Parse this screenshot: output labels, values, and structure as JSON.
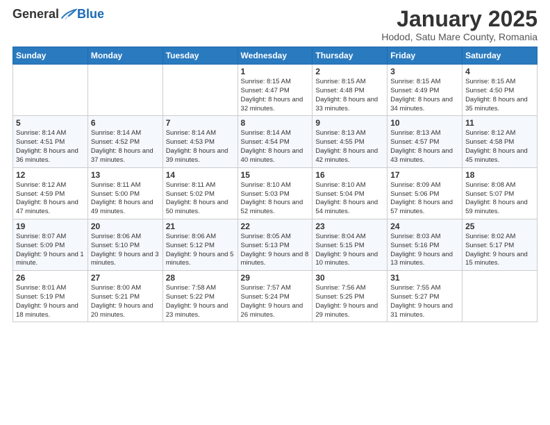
{
  "header": {
    "logo_general": "General",
    "logo_blue": "Blue",
    "cal_title": "January 2025",
    "cal_subtitle": "Hodod, Satu Mare County, Romania"
  },
  "weekdays": [
    "Sunday",
    "Monday",
    "Tuesday",
    "Wednesday",
    "Thursday",
    "Friday",
    "Saturday"
  ],
  "weeks": [
    [
      {
        "day": "",
        "info": ""
      },
      {
        "day": "",
        "info": ""
      },
      {
        "day": "",
        "info": ""
      },
      {
        "day": "1",
        "info": "Sunrise: 8:15 AM\nSunset: 4:47 PM\nDaylight: 8 hours\nand 32 minutes."
      },
      {
        "day": "2",
        "info": "Sunrise: 8:15 AM\nSunset: 4:48 PM\nDaylight: 8 hours\nand 33 minutes."
      },
      {
        "day": "3",
        "info": "Sunrise: 8:15 AM\nSunset: 4:49 PM\nDaylight: 8 hours\nand 34 minutes."
      },
      {
        "day": "4",
        "info": "Sunrise: 8:15 AM\nSunset: 4:50 PM\nDaylight: 8 hours\nand 35 minutes."
      }
    ],
    [
      {
        "day": "5",
        "info": "Sunrise: 8:14 AM\nSunset: 4:51 PM\nDaylight: 8 hours\nand 36 minutes."
      },
      {
        "day": "6",
        "info": "Sunrise: 8:14 AM\nSunset: 4:52 PM\nDaylight: 8 hours\nand 37 minutes."
      },
      {
        "day": "7",
        "info": "Sunrise: 8:14 AM\nSunset: 4:53 PM\nDaylight: 8 hours\nand 39 minutes."
      },
      {
        "day": "8",
        "info": "Sunrise: 8:14 AM\nSunset: 4:54 PM\nDaylight: 8 hours\nand 40 minutes."
      },
      {
        "day": "9",
        "info": "Sunrise: 8:13 AM\nSunset: 4:55 PM\nDaylight: 8 hours\nand 42 minutes."
      },
      {
        "day": "10",
        "info": "Sunrise: 8:13 AM\nSunset: 4:57 PM\nDaylight: 8 hours\nand 43 minutes."
      },
      {
        "day": "11",
        "info": "Sunrise: 8:12 AM\nSunset: 4:58 PM\nDaylight: 8 hours\nand 45 minutes."
      }
    ],
    [
      {
        "day": "12",
        "info": "Sunrise: 8:12 AM\nSunset: 4:59 PM\nDaylight: 8 hours\nand 47 minutes."
      },
      {
        "day": "13",
        "info": "Sunrise: 8:11 AM\nSunset: 5:00 PM\nDaylight: 8 hours\nand 49 minutes."
      },
      {
        "day": "14",
        "info": "Sunrise: 8:11 AM\nSunset: 5:02 PM\nDaylight: 8 hours\nand 50 minutes."
      },
      {
        "day": "15",
        "info": "Sunrise: 8:10 AM\nSunset: 5:03 PM\nDaylight: 8 hours\nand 52 minutes."
      },
      {
        "day": "16",
        "info": "Sunrise: 8:10 AM\nSunset: 5:04 PM\nDaylight: 8 hours\nand 54 minutes."
      },
      {
        "day": "17",
        "info": "Sunrise: 8:09 AM\nSunset: 5:06 PM\nDaylight: 8 hours\nand 57 minutes."
      },
      {
        "day": "18",
        "info": "Sunrise: 8:08 AM\nSunset: 5:07 PM\nDaylight: 8 hours\nand 59 minutes."
      }
    ],
    [
      {
        "day": "19",
        "info": "Sunrise: 8:07 AM\nSunset: 5:09 PM\nDaylight: 9 hours\nand 1 minute."
      },
      {
        "day": "20",
        "info": "Sunrise: 8:06 AM\nSunset: 5:10 PM\nDaylight: 9 hours\nand 3 minutes."
      },
      {
        "day": "21",
        "info": "Sunrise: 8:06 AM\nSunset: 5:12 PM\nDaylight: 9 hours\nand 5 minutes."
      },
      {
        "day": "22",
        "info": "Sunrise: 8:05 AM\nSunset: 5:13 PM\nDaylight: 9 hours\nand 8 minutes."
      },
      {
        "day": "23",
        "info": "Sunrise: 8:04 AM\nSunset: 5:15 PM\nDaylight: 9 hours\nand 10 minutes."
      },
      {
        "day": "24",
        "info": "Sunrise: 8:03 AM\nSunset: 5:16 PM\nDaylight: 9 hours\nand 13 minutes."
      },
      {
        "day": "25",
        "info": "Sunrise: 8:02 AM\nSunset: 5:17 PM\nDaylight: 9 hours\nand 15 minutes."
      }
    ],
    [
      {
        "day": "26",
        "info": "Sunrise: 8:01 AM\nSunset: 5:19 PM\nDaylight: 9 hours\nand 18 minutes."
      },
      {
        "day": "27",
        "info": "Sunrise: 8:00 AM\nSunset: 5:21 PM\nDaylight: 9 hours\nand 20 minutes."
      },
      {
        "day": "28",
        "info": "Sunrise: 7:58 AM\nSunset: 5:22 PM\nDaylight: 9 hours\nand 23 minutes."
      },
      {
        "day": "29",
        "info": "Sunrise: 7:57 AM\nSunset: 5:24 PM\nDaylight: 9 hours\nand 26 minutes."
      },
      {
        "day": "30",
        "info": "Sunrise: 7:56 AM\nSunset: 5:25 PM\nDaylight: 9 hours\nand 29 minutes."
      },
      {
        "day": "31",
        "info": "Sunrise: 7:55 AM\nSunset: 5:27 PM\nDaylight: 9 hours\nand 31 minutes."
      },
      {
        "day": "",
        "info": ""
      }
    ]
  ]
}
